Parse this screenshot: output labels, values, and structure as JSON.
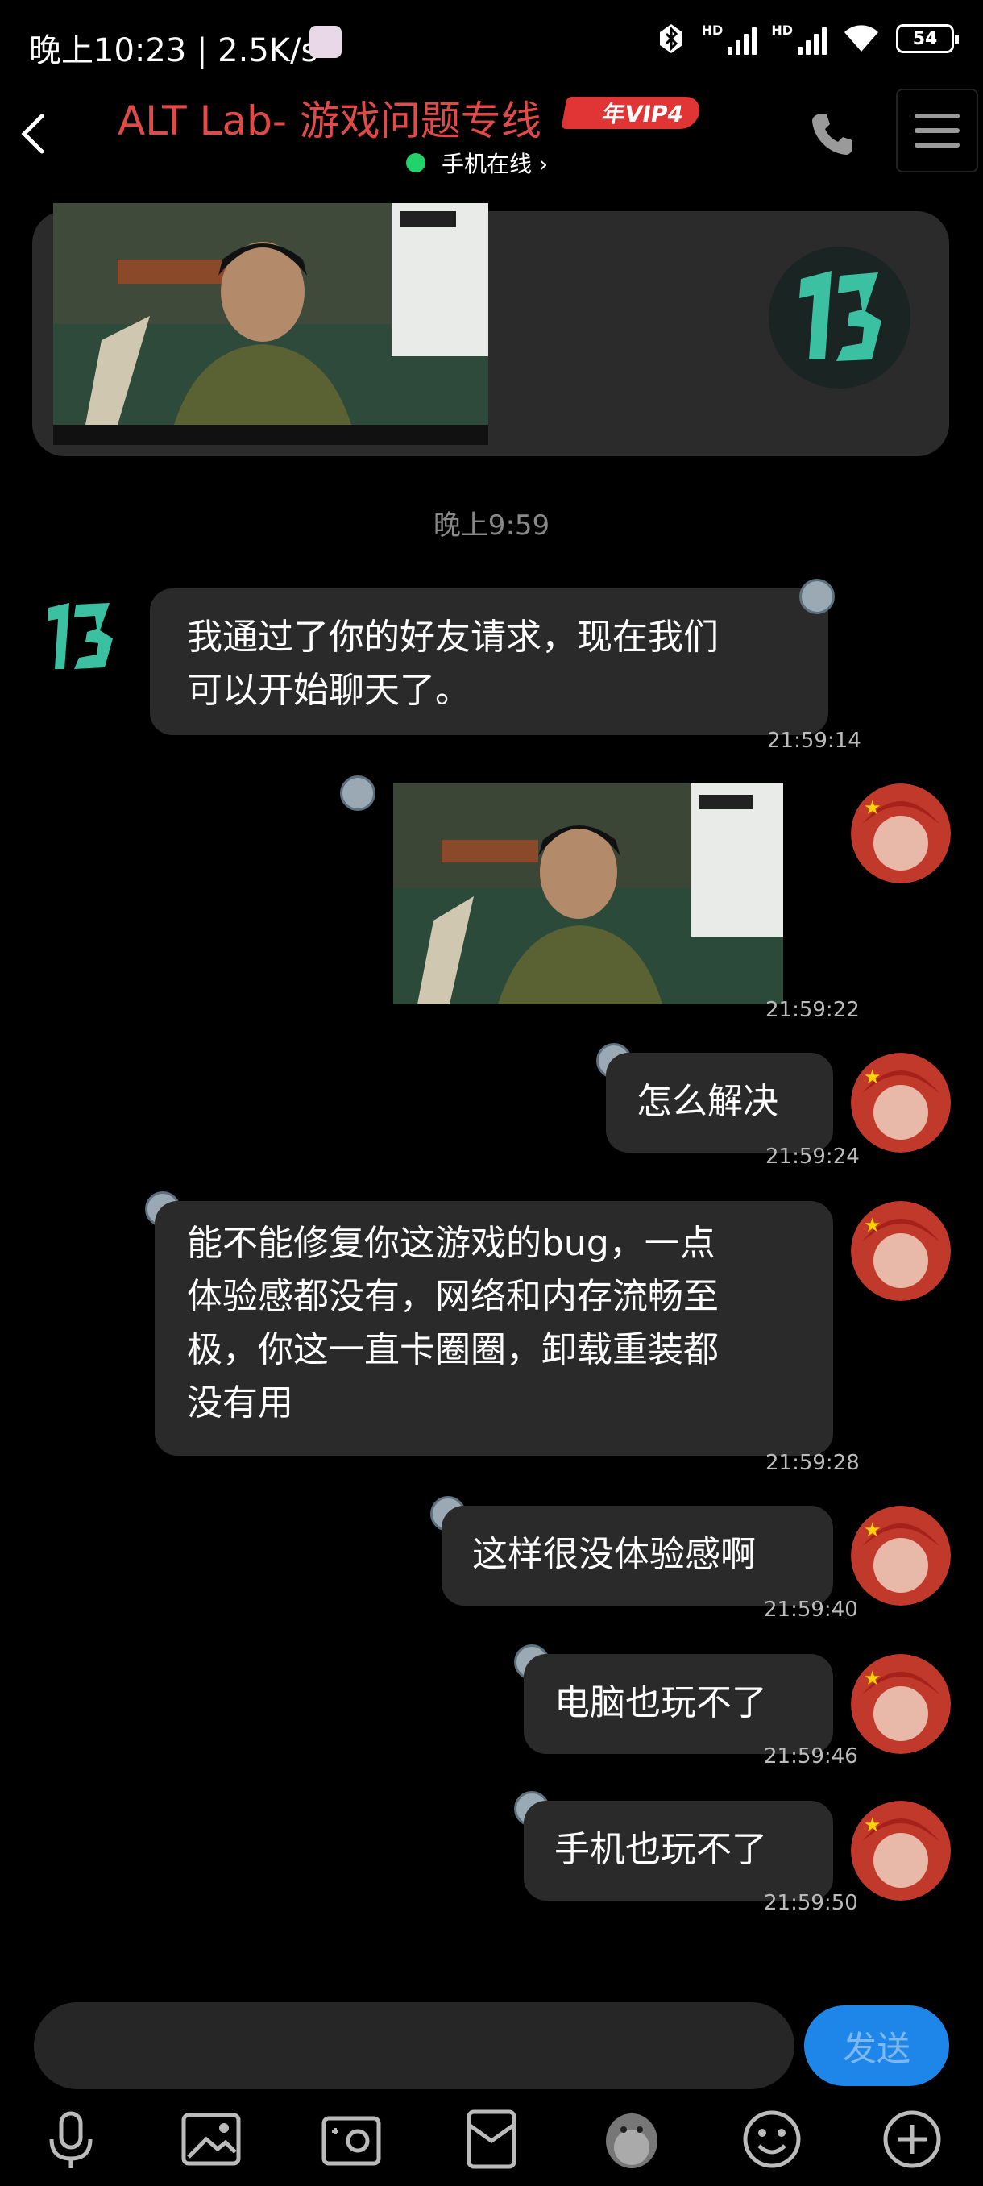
{
  "status_bar": {
    "time": "晚上10:23 | 2.5K/s",
    "battery": "54",
    "hd1": "HD",
    "hd2": "HD"
  },
  "header": {
    "title": "ALT Lab- 游戏问题专线",
    "vip_badge": "年VIP4",
    "online_status": "手机在线 ›"
  },
  "divider_time": "晚上9:59",
  "messages": [
    {
      "direction": "in",
      "text": "我通过了你的好友请求，现在我们\n可以开始聊天了。",
      "time": "21:59:14"
    },
    {
      "direction": "out",
      "type": "image",
      "time": "21:59:22"
    },
    {
      "direction": "out",
      "text": "怎么解决",
      "time": "21:59:24"
    },
    {
      "direction": "out",
      "text": "能不能修复你这游戏的bug，一点\n体验感都没有，网络和内存流畅至\n极，你这一直卡圈圈，卸载重装都\n没有用",
      "time": "21:59:28"
    },
    {
      "direction": "out",
      "text": "这样很没体验感啊",
      "time": "21:59:40"
    },
    {
      "direction": "out",
      "text": "电脑也玩不了",
      "time": "21:59:46"
    },
    {
      "direction": "out",
      "text": "手机也玩不了",
      "time": "21:59:50"
    }
  ],
  "composer": {
    "send_label": "发送",
    "input_value": ""
  },
  "toolbar_icons": [
    "microphone-icon",
    "image-icon",
    "camera-icon",
    "red-packet-icon",
    "penguin-icon",
    "emoji-icon",
    "plus-icon"
  ],
  "colors": {
    "background": "#000000",
    "bubble": "#2a2a2a",
    "title": "#e24a4a",
    "send_button": "#1e86e8",
    "online_dot": "#22d26a"
  }
}
